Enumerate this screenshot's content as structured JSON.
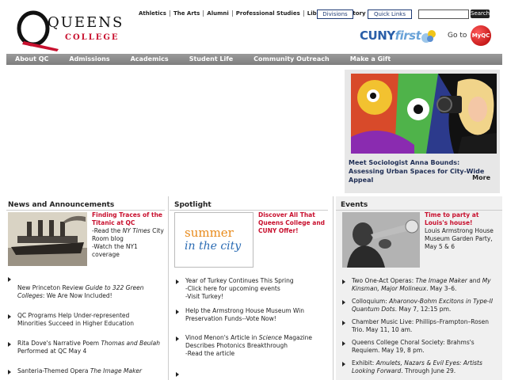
{
  "brand": {
    "name_top": "QUEENS",
    "name_bottom": "COLLEGE",
    "accent": "#c8102e",
    "navy": "#1f3b75"
  },
  "toplinks": [
    "Athletics",
    "The Arts",
    "Alumni",
    "Professional Studies",
    "Library",
    "Directory"
  ],
  "header": {
    "divisions_label": "Divisions",
    "quicklinks_label": "Quick Links",
    "search_value": "",
    "search_button": "Search",
    "cuny_main": "CUNY",
    "cuny_first": "first",
    "goto_label": "Go to",
    "myqc_label": "MyQC"
  },
  "nav": [
    "About QC",
    "Admissions",
    "Academics",
    "Student Life",
    "Community Outreach",
    "Make a Gift"
  ],
  "feature": {
    "caption": "Meet Sociologist Anna Bounds: Assessing Urban Spaces for City-Wide Appeal",
    "more": "More"
  },
  "news": {
    "heading": "News and Announcements",
    "feature_title": "Finding Traces of the Titanic at QC",
    "feature_lines": [
      "-Read the ",
      "NY Times",
      " City Room blog",
      "-Watch the NY1 coverage"
    ],
    "items": [
      {
        "plain": "New Princeton Review ",
        "italic": "Guide to 322 Green Colleges",
        "rest": ": We Are Now Included!"
      },
      {
        "plain": "QC Programs Help Under-represented Minorities Succeed in Higher Education",
        "italic": "",
        "rest": ""
      },
      {
        "plain": "Rita Dove's Narrative Poem ",
        "italic": "Thomas and Beulah",
        "rest": " Performed at QC May 4"
      },
      {
        "plain": "Santeria-Themed Opera ",
        "italic": "The Image Maker",
        "rest": ""
      }
    ]
  },
  "spotlight": {
    "heading": "Spotlight",
    "summer": "summer",
    "city": "in the city",
    "feature_title": "Discover All That Queens College and CUNY Offer!",
    "items": [
      {
        "plain": "Year of Turkey Continues This Spring",
        "italic": "",
        "rest": "",
        "sub": [
          "-Click here for upcoming events",
          "-Visit Turkey!"
        ]
      },
      {
        "plain": "Help the Armstrong House Museum Win Preservation Funds--Vote Now!",
        "italic": "",
        "rest": "",
        "sub": []
      },
      {
        "plain": "Vinod Menon's Article in ",
        "italic": "Science",
        "rest": " Magazine Describes Photonics Breakthrough",
        "sub": [
          "-Read the article"
        ]
      },
      {
        "plain": "",
        "italic": "",
        "rest": "",
        "sub": []
      }
    ]
  },
  "events": {
    "heading": "Events",
    "feature_title": "Time to party at Louis's house!",
    "feature_text": "Louis Armstrong House Museum Garden Party, May 5 & 6",
    "items": [
      {
        "plain": "Two One-Act Operas: ",
        "italic": "The Image Maker",
        "rest": " and ",
        "italic2": "My Kinsman, Major Molineux",
        "tail": ". May 3–6."
      },
      {
        "plain": "Colloquium: ",
        "italic": "Aharonov-Bohm Excitons in Type-II Quantum Dots",
        "rest": ". May 7, 12:15 pm.",
        "italic2": "",
        "tail": ""
      },
      {
        "plain": "Chamber Music Live: Phillips–Frampton–Rosen Trio. May 11, 10 am.",
        "italic": "",
        "rest": "",
        "italic2": "",
        "tail": ""
      },
      {
        "plain": "Queens College Choral Society: Brahms's Requiem. May 19, 8 pm.",
        "italic": "",
        "rest": "",
        "italic2": "",
        "tail": ""
      },
      {
        "plain": "Exhibit: ",
        "italic": "Amulets, Nazars & Evil Eyes: Artists Looking Forward",
        "rest": ". Through June 29.",
        "italic2": "",
        "tail": ""
      }
    ]
  }
}
